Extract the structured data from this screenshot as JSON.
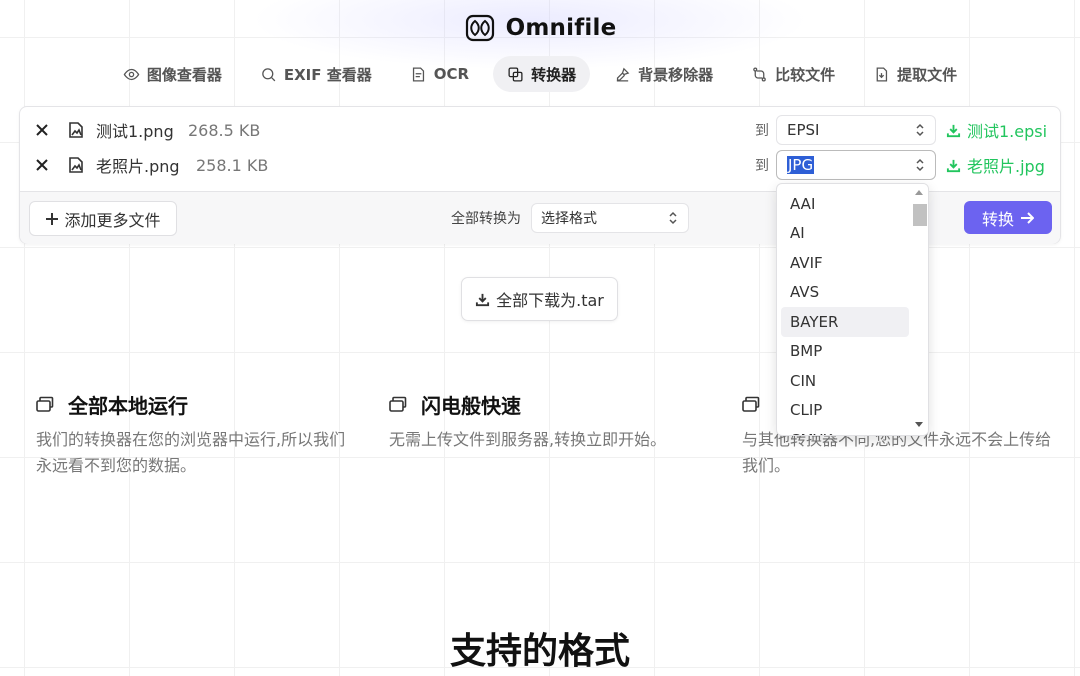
{
  "brand": {
    "name": "Omnifile"
  },
  "nav": {
    "items": [
      {
        "label": "图像查看器",
        "icon": "eye-icon"
      },
      {
        "label": "EXIF 查看器",
        "icon": "search-icon"
      },
      {
        "label": "OCR",
        "icon": "document-text-icon"
      },
      {
        "label": "转换器",
        "icon": "convert-icon",
        "active": true
      },
      {
        "label": "背景移除器",
        "icon": "brush-icon"
      },
      {
        "label": "比较文件",
        "icon": "git-compare-icon"
      },
      {
        "label": "提取文件",
        "icon": "file-extract-icon"
      }
    ]
  },
  "files": [
    {
      "name": "测试1.png",
      "size": "268.5 KB",
      "to_label": "到",
      "format": "EPSI",
      "download": "测试1.epsi"
    },
    {
      "name": "老照片.png",
      "size": "258.1 KB",
      "to_label": "到",
      "format": "JPG",
      "download": "老照片.jpg"
    }
  ],
  "footer": {
    "add_more": "添加更多文件",
    "convert_all_label": "全部转换为",
    "convert_all_placeholder": "选择格式",
    "convert_button": "转换"
  },
  "download_all": "全部下载为.tar",
  "dropdown": {
    "options": [
      "AAI",
      "AI",
      "AVIF",
      "AVS",
      "BAYER",
      "BMP",
      "CIN",
      "CLIP",
      "CMYK"
    ],
    "hovered": "BAYER"
  },
  "features": [
    {
      "title": "全部本地运行",
      "desc": "我们的转换器在您的浏览器中运行,所以我们永远看不到您的数据。"
    },
    {
      "title": "闪电般快速",
      "desc": "无需上传文件到服务器,转换立即开始。"
    },
    {
      "title": "",
      "desc": "与其他转换器不同,您的文件永远不会上传给我们。"
    }
  ],
  "section_title": "支持的格式",
  "colors": {
    "accent": "#6c63f0",
    "success": "#22c55e",
    "selection": "#2e5fd6"
  }
}
